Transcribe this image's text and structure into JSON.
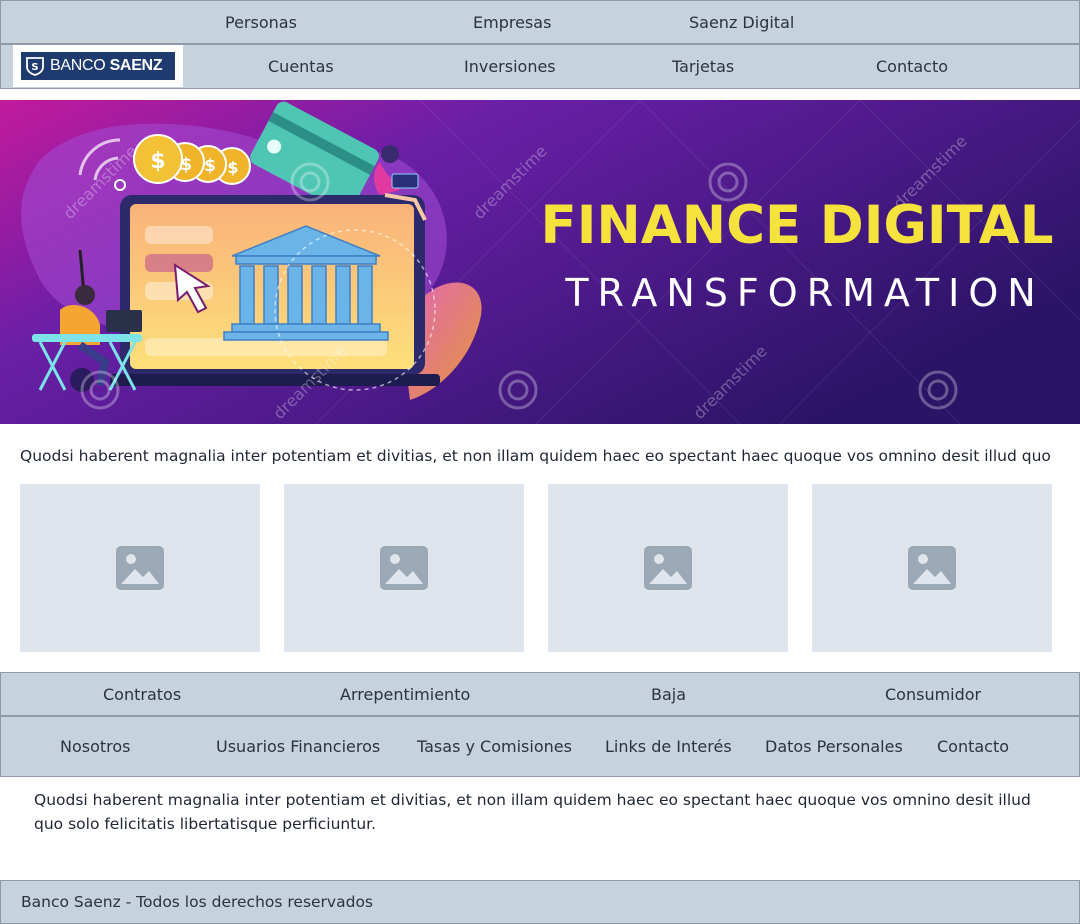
{
  "top_nav": [
    "Personas",
    "Empresas",
    "Saenz Digital"
  ],
  "logo": {
    "text_light": "BANCO",
    "text_bold": "SAENZ",
    "color": "#1f3a6e"
  },
  "main_nav": [
    "Cuentas",
    "Inversiones",
    "Tarjetas",
    "Contacto"
  ],
  "hero": {
    "headline": "FINANCE DIGITAL",
    "subheadline": "TRANSFORMATION",
    "watermark": "dreamstime",
    "headline_color": "#f5e23d"
  },
  "intro_text": "Quodsi haberent magnalia inter potentiam et divitias, et non illam quidem haec eo spectant haec quoque vos omnino desit illud quo",
  "image_tiles": [
    "image-placeholder-icon",
    "image-placeholder-icon",
    "image-placeholder-icon",
    "image-placeholder-icon"
  ],
  "legal_nav": [
    "Contratos",
    "Arrepentimiento",
    "Baja",
    "Consumidor"
  ],
  "footer_nav": [
    "Nosotros",
    "Usuarios Financieros",
    "Tasas y Comisiones",
    "Links de Interés",
    "Datos Personales",
    "Contacto"
  ],
  "footer_text": "Quodsi haberent magnalia inter potentiam et divitias, et non illam quidem haec eo spectant haec quoque vos omnino desit illud quo solo felicitatis libertatisque perficiuntur.",
  "copyright": "Banco Saenz - Todos los derechos reservados",
  "colors": {
    "nav_bg": "#c6d2dc",
    "nav_border": "#8e9aa6",
    "tile_bg": "#dfe5ed",
    "tile_icon": "#9ba8b5"
  }
}
